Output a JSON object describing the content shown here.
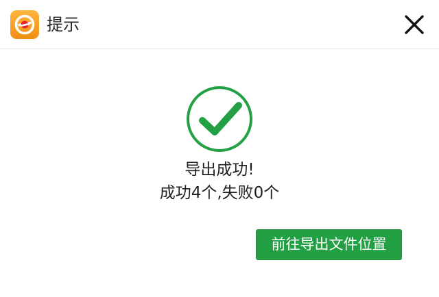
{
  "dialog": {
    "title": "提示",
    "app_icon": "app-logo-icon",
    "close_icon": "close-icon"
  },
  "status": {
    "icon": "checkmark-circle-icon",
    "icon_color": "#22a043",
    "message": "导出成功!",
    "detail": "成功4个,失败0个"
  },
  "actions": {
    "open_location_label": "前往导出文件位置",
    "button_color": "#22a043"
  }
}
